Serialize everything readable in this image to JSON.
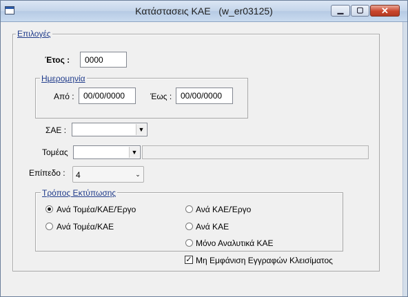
{
  "window": {
    "title": "Κατάστασεις ΚΑΕ   (w_er03125)"
  },
  "options_group": {
    "legend": "Επιλογές"
  },
  "year": {
    "label": "Έτος :",
    "value": "0000"
  },
  "date_group": {
    "legend": "Ημερομηνία",
    "from_label": "Από :",
    "from_value": "00/00/0000",
    "to_label": "Έως :",
    "to_value": "00/00/0000"
  },
  "sae": {
    "label": "ΣΑΕ :",
    "value": ""
  },
  "sector": {
    "label": "Τομέας",
    "value": "",
    "description": ""
  },
  "level": {
    "label": "Επίπεδο :",
    "value": "4"
  },
  "print_mode": {
    "legend": "Τρόπος  Εκτύπωσης",
    "options": [
      {
        "label": "Ανά Τομέα/ΚΑΕ/Έργο",
        "selected": true
      },
      {
        "label": "Ανά ΚΑΕ/Έργο",
        "selected": false
      },
      {
        "label": "Ανά Τομέα/ΚΑΕ",
        "selected": false
      },
      {
        "label": "Ανά ΚΑΕ",
        "selected": false
      },
      {
        "label": "Μόνο Αναλυτικά ΚΑΕ",
        "selected": false
      }
    ]
  },
  "hide_closing": {
    "label": "Μη Εμφάνιση Εγγραφών Κλεισίματος",
    "checked": true
  },
  "icons": {
    "minimize": "minimize-icon",
    "maximize": "maximize-icon",
    "close": "close-icon",
    "dropdown": "chevron-down-icon"
  }
}
